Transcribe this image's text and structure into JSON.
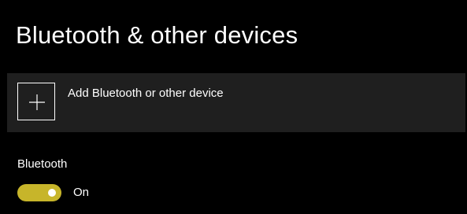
{
  "page": {
    "title": "Bluetooth & other devices"
  },
  "add_device": {
    "label": "Add Bluetooth or other device",
    "icon": "plus-icon"
  },
  "bluetooth": {
    "section_label": "Bluetooth",
    "toggle_state": "On",
    "toggle_on": true
  },
  "colors": {
    "background": "#000000",
    "card_background": "#1f1f1f",
    "accent": "#c7b52a",
    "text": "#ffffff"
  }
}
